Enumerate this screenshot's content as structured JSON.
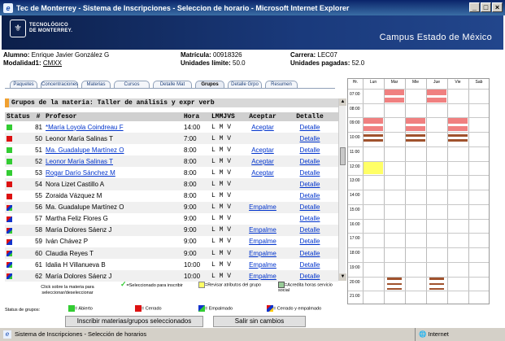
{
  "window": {
    "title": "Tec de Monterrey - Sistema de Inscripciones - Seleccion de horario - Microsoft Internet Explorer"
  },
  "banner": {
    "logo_line1": "TECNOLÓGICO",
    "logo_line2": "DE MONTERREY.",
    "campus": "Campus Estado de México"
  },
  "student": {
    "alumno_label": "Alumno:",
    "alumno": "Enrique Javier González G",
    "modalidad_label": "Modalidad1:",
    "modalidad": "CMXX",
    "matricula_label": "Matrícula:",
    "matricula": "00918326",
    "limite_label": "Unidades límite:",
    "limite": "50.0",
    "carrera_label": "Carrera:",
    "carrera": "LEC07",
    "pagadas_label": "Unidades pagadas:",
    "pagadas": "52.0"
  },
  "tabs": [
    "Paquetes",
    "Concentraciones",
    "Materias",
    "Cursos",
    "Detalle Mat",
    "Grupos",
    "Detalle Grpo",
    "Resumen"
  ],
  "groups": {
    "header": "Grupos de la materia: Taller de análisis y expr verb",
    "columns": [
      "Status",
      "#",
      "Profesor",
      "Hora",
      "LMMJVS",
      "Aceptar",
      "Detalle"
    ],
    "rows": [
      {
        "status": "green",
        "num": "81",
        "prof": "*María Loyola Coindreau F",
        "link": true,
        "hora": "14:00",
        "dias": "L M V",
        "aceptar": "Aceptar",
        "detalle": "Detalle"
      },
      {
        "status": "red",
        "num": "50",
        "prof": "Leonor María Salinas T",
        "link": false,
        "hora": "7:00",
        "dias": "L M V",
        "aceptar": "",
        "detalle": "Detalle"
      },
      {
        "status": "green",
        "num": "51",
        "prof": "Ma. Guadalupe Martínez O",
        "link": true,
        "hora": "8:00",
        "dias": "L M V",
        "aceptar": "Aceptar",
        "detalle": "Detalle"
      },
      {
        "status": "green",
        "num": "52",
        "prof": "Leonor María Salinas T",
        "link": true,
        "hora": "8:00",
        "dias": "L M V",
        "aceptar": "Aceptar",
        "detalle": "Detalle"
      },
      {
        "status": "green",
        "num": "53",
        "prof": "Rogar Darío Sánchez M",
        "link": true,
        "hora": "8:00",
        "dias": "L M V",
        "aceptar": "Aceptar",
        "detalle": "Detalle"
      },
      {
        "status": "red",
        "num": "54",
        "prof": "Nora Lizet Castillo A",
        "link": false,
        "hora": "8:00",
        "dias": "L M V",
        "aceptar": "",
        "detalle": "Detalle"
      },
      {
        "status": "red",
        "num": "55",
        "prof": "Zoraida Vázquez M",
        "link": false,
        "hora": "8:00",
        "dias": "L M V",
        "aceptar": "",
        "detalle": "Detalle"
      },
      {
        "status": "multi",
        "num": "56",
        "prof": "Ma. Guadalupe Martínez O",
        "link": false,
        "hora": "9:00",
        "dias": "L M V",
        "aceptar": "Empalme",
        "detalle": "Detalle"
      },
      {
        "status": "multi2",
        "num": "57",
        "prof": "Martha Feliz Flores G",
        "link": false,
        "hora": "9:00",
        "dias": "L M V",
        "aceptar": "",
        "detalle": "Detalle"
      },
      {
        "status": "multi",
        "num": "58",
        "prof": "María Dolores Sáenz J",
        "link": false,
        "hora": "9:00",
        "dias": "L M V",
        "aceptar": "Empalme",
        "detalle": "Detalle"
      },
      {
        "status": "multi2",
        "num": "59",
        "prof": "Iván Chávez P",
        "link": false,
        "hora": "9:00",
        "dias": "L M V",
        "aceptar": "Empalme",
        "detalle": "Detalle"
      },
      {
        "status": "multi",
        "num": "60",
        "prof": "Claudia Reyes T",
        "link": false,
        "hora": "9:00",
        "dias": "L M V",
        "aceptar": "Empalme",
        "detalle": "Detalle"
      },
      {
        "status": "multi",
        "num": "61",
        "prof": "Idalia H Villanueva B",
        "link": false,
        "hora": "10:00",
        "dias": "L M V",
        "aceptar": "Empalme",
        "detalle": "Detalle"
      },
      {
        "status": "multi",
        "num": "62",
        "prof": "María Dolores Sáenz J",
        "link": false,
        "hora": "10:00",
        "dias": "L M V",
        "aceptar": "Empalme",
        "detalle": "Detalle"
      }
    ]
  },
  "legend": {
    "click_line1": "Click sobre la materia para",
    "click_line2": "seleccionar/deseleccionar",
    "seleccionado": "=Seleccionado para inscribir",
    "revisar": "=Revisar atributos del grupo",
    "acredita": "=Acredita horas servicio social",
    "status_label": "Status de grupos:",
    "abierto": "= Abierto",
    "cerrado": "= Cerrado",
    "empalmado": "= Empalmado",
    "cerrado_empalmado": "= Cerrado y empalmado"
  },
  "buttons": {
    "inscribir": "Inscribir materias/grupos seleccionados",
    "salir": "Salir sin cambios"
  },
  "schedule": {
    "days": [
      "Hr.",
      "Lun",
      "Mar",
      "Mie",
      "Jue",
      "Vie",
      "Sab"
    ],
    "hours": [
      "07:00",
      "08:00",
      "09:00",
      "10:00",
      "11:00",
      "12:00",
      "13:00",
      "14:00",
      "15:00",
      "16:00",
      "17:00",
      "18:00",
      "19:00",
      "20:00",
      "21:00"
    ]
  },
  "statusbar": {
    "text": "Sistema de Inscripciones - Selección de horarios",
    "zone": "Internet"
  },
  "colors": {
    "banner": "#1a3a7c",
    "open": "#33cc33",
    "closed": "#dd1111",
    "link": "#0033cc",
    "pink": "#f08080",
    "brown": "#a0522d",
    "yellow": "#ffff66"
  }
}
